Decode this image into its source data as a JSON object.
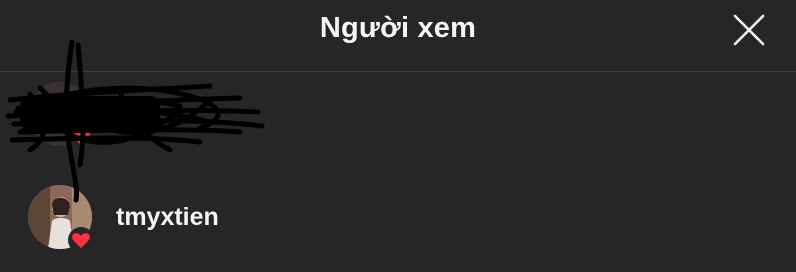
{
  "dialog": {
    "title": "Người xem",
    "close_icon": "close-icon"
  },
  "viewers": [
    {
      "username": "",
      "redacted": true,
      "liked": true
    },
    {
      "username": "tmyxtien",
      "redacted": false,
      "liked": true
    }
  ],
  "colors": {
    "background": "#262626",
    "text": "#f5f5f5",
    "divider": "#3a3a3a",
    "heart": "#ff3040"
  }
}
